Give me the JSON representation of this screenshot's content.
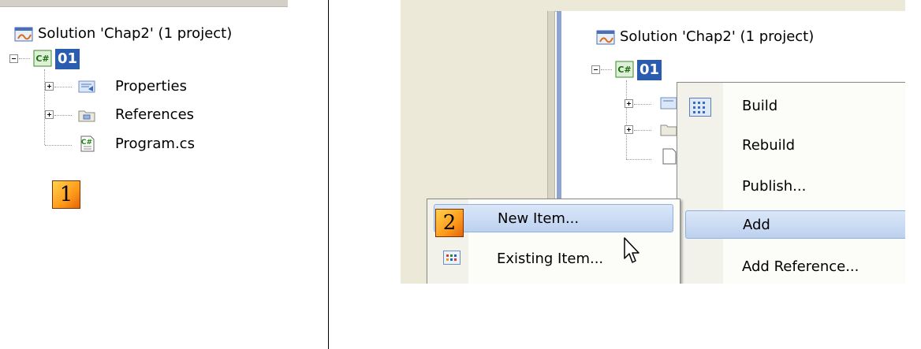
{
  "left_panel": {
    "solution_label": "Solution 'Chap2' (1 project)",
    "project_label": "01",
    "project_icon_text": "C#",
    "items": [
      {
        "label": "Properties",
        "expander": "plus"
      },
      {
        "label": "References",
        "expander": "plus"
      },
      {
        "label": "Program.cs",
        "expander": "none"
      }
    ],
    "file_icon_text": "C#",
    "step_badge": "1"
  },
  "right_panel": {
    "solution_label": "Solution 'Chap2' (1 project)",
    "project_label": "01",
    "project_icon_text": "C#",
    "context_menu": {
      "items": [
        "Build",
        "Rebuild",
        "Publish...",
        "Add",
        "Add Reference..."
      ],
      "highlighted": "Add"
    },
    "submenu": {
      "items": [
        "New Item...",
        "Existing Item..."
      ],
      "highlighted": "New Item..."
    },
    "step_badge": "2"
  },
  "colors": {
    "selection": "#2a5db0",
    "menu_highlight": "#c5d8f2",
    "badge_orange": "#ff9a1a"
  },
  "icons": {
    "solution": "solution-icon",
    "project": "csharp-project-icon",
    "properties": "properties-icon",
    "references": "references-icon",
    "file": "csharp-file-icon",
    "build": "build-icon",
    "existing_item": "existing-item-icon",
    "cursor": "mouse-cursor-icon"
  }
}
